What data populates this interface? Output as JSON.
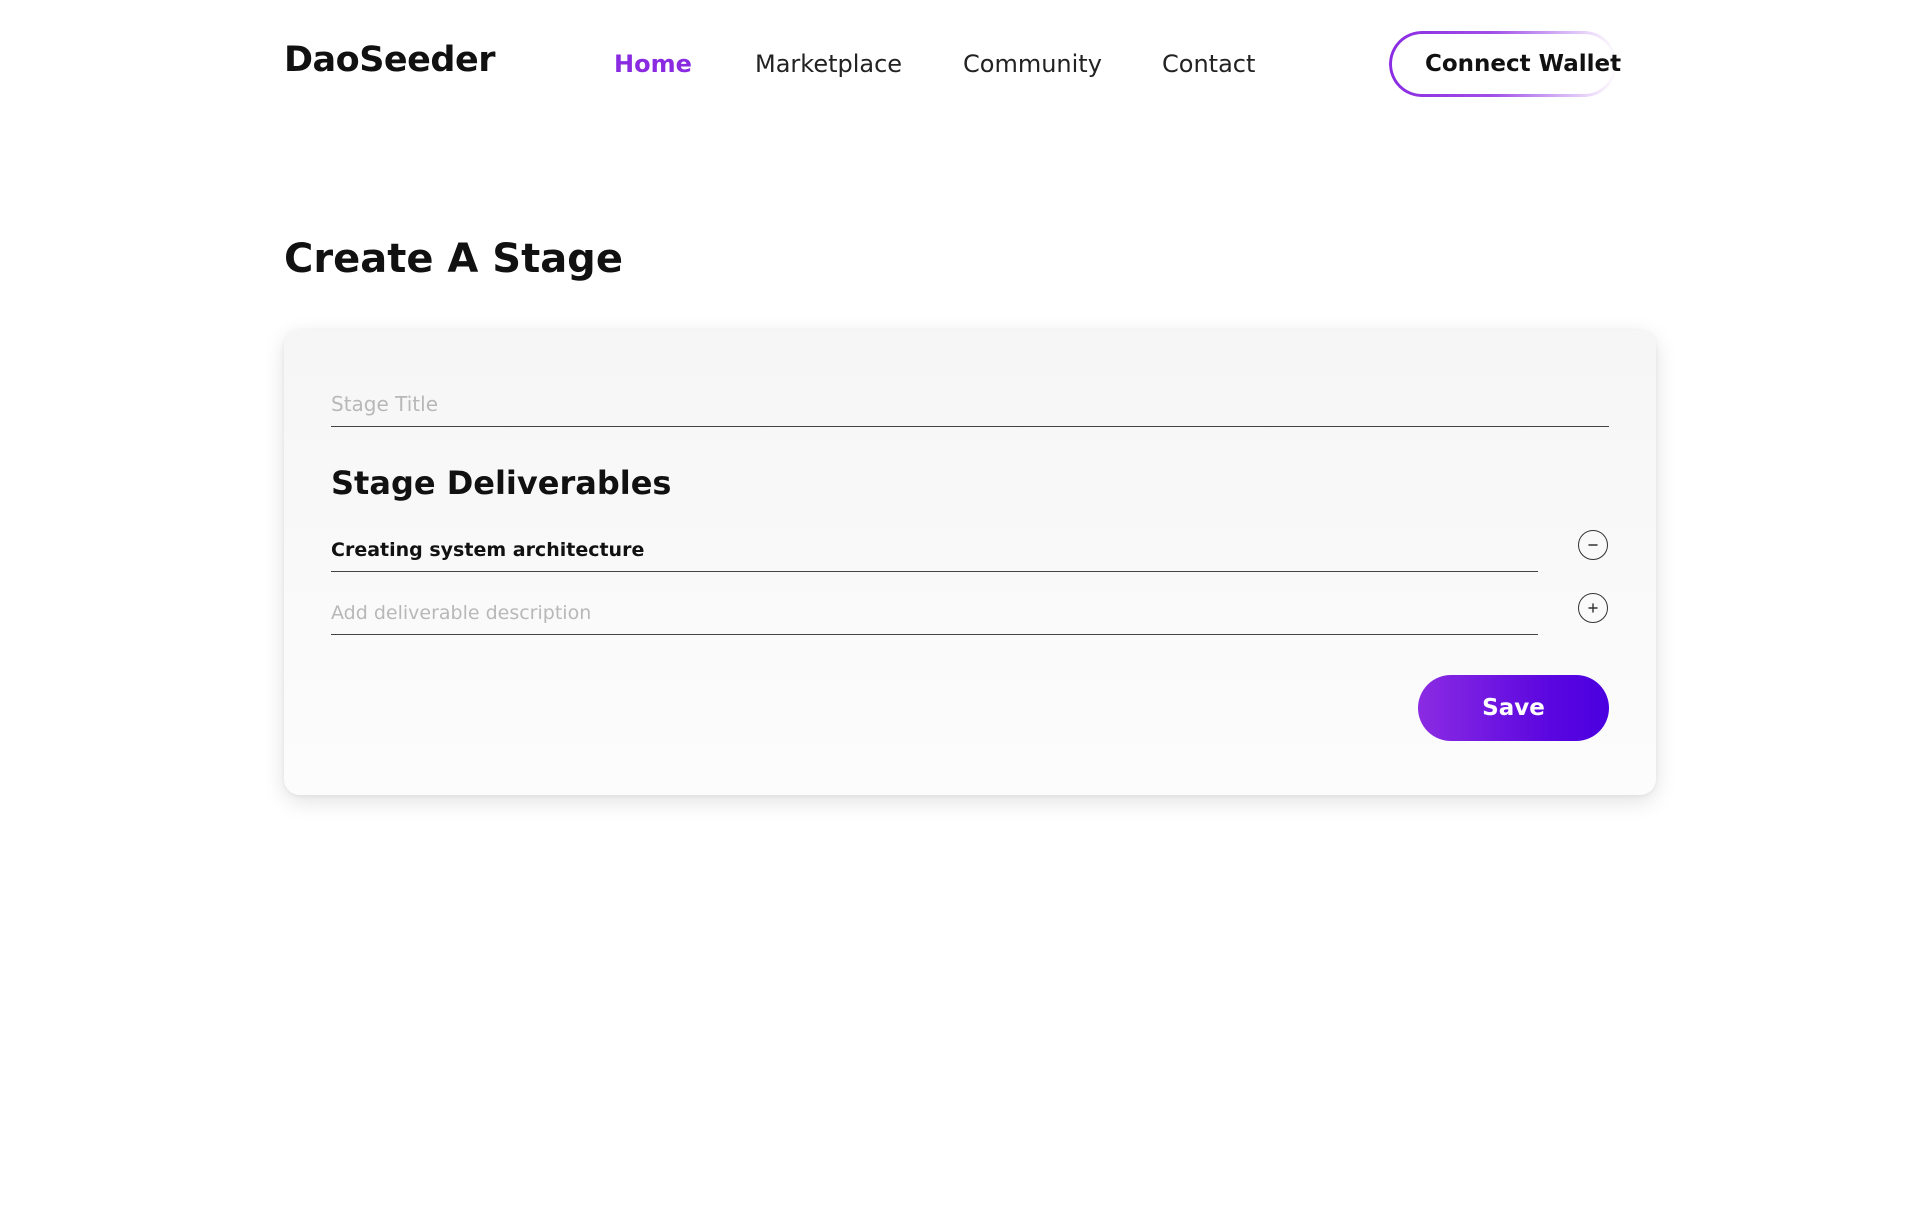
{
  "brand": {
    "name": "DaoSeeder"
  },
  "nav": {
    "items": [
      {
        "label": "Home",
        "active": true
      },
      {
        "label": "Marketplace",
        "active": false
      },
      {
        "label": "Community",
        "active": false
      },
      {
        "label": "Contact",
        "active": false
      }
    ],
    "wallet_button_label": "Connect Wallet"
  },
  "page": {
    "title": "Create A Stage"
  },
  "form": {
    "stage_title": {
      "value": "",
      "placeholder": "Stage Title"
    },
    "deliverables_heading": "Stage Deliverables",
    "deliverables": [
      {
        "value": "Creating system architecture",
        "action_icon": "minus-circle-icon"
      }
    ],
    "new_deliverable": {
      "value": "",
      "placeholder": "Add deliverable description",
      "action_icon": "plus-circle-icon"
    },
    "save_label": "Save"
  },
  "colors": {
    "accent": "#8a2be2",
    "save_gradient_start": "#8b2be2",
    "save_gradient_end": "#4a00e0",
    "text": "#111111",
    "placeholder": "#b8b8b8"
  }
}
